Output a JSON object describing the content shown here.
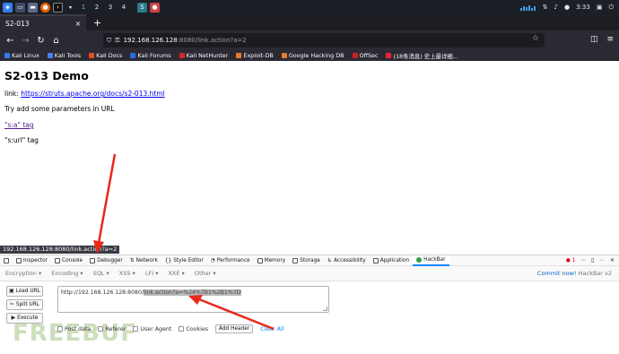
{
  "taskbar": {
    "workspaces": [
      "1",
      "2",
      "3",
      "4"
    ],
    "time": "3:33"
  },
  "browser": {
    "tab_title": "S2-013",
    "tab_close": "×",
    "new_tab": "+",
    "url_host": "192.168.126.128",
    "url_rest": ":8080/link.action?a=2"
  },
  "bookmarks": [
    "Kali Linux",
    "Kali Tools",
    "Kali Docs",
    "Kali Forums",
    "Kali NetHunter",
    "Exploit-DB",
    "Google Hacking DB",
    "OffSec",
    "(18条消息) 史上最详细..."
  ],
  "bookmark_colors": [
    "#367bf0",
    "#4c7ef0",
    "#e34c26",
    "#2b6de0",
    "#d8232a",
    "#e57a2c",
    "#888888",
    "#c22",
    "#e23"
  ],
  "page": {
    "heading": "S2-013 Demo",
    "link_label": "link: ",
    "link_url": "https://struts.apache.org/docs/s2-013.html",
    "hint": "Try add some parameters in URL",
    "sa_tag": "\"s:a\" tag",
    "surl_tag": "\"s:url\" tag"
  },
  "status_url": "192.168.126.128:8080/link.action?a=2",
  "devtools": {
    "tabs": [
      "Inspector",
      "Console",
      "Debugger",
      "Network",
      "Style Editor",
      "Performance",
      "Memory",
      "Storage",
      "Accessibility",
      "Application",
      "HackBar"
    ],
    "active_tab": "HackBar",
    "error_count": "1"
  },
  "hackbar": {
    "menu": [
      "Encryption",
      "Encoding",
      "SQL",
      "XSS",
      "LFI",
      "XXE",
      "Other"
    ],
    "commit_text": "Commit now!",
    "version_text": "HackBar v2",
    "load_url": "Load URL",
    "split_url": "Split URL",
    "execute": "Execute",
    "url_prefix": "http://192.168.126.128:8080/",
    "url_selected": "link.action?a=%24%7B1%2B1%7D",
    "checkboxes": [
      "Post data",
      "Referer",
      "User Agent",
      "Cookies"
    ],
    "add_header": "Add Header",
    "clear_all": "Clear All"
  },
  "watermark": "FREEBUF",
  "colors": {
    "annotation_arrow": "#e8291c",
    "accent": "#0a84ff",
    "hackbar_green": "#2ea043"
  }
}
